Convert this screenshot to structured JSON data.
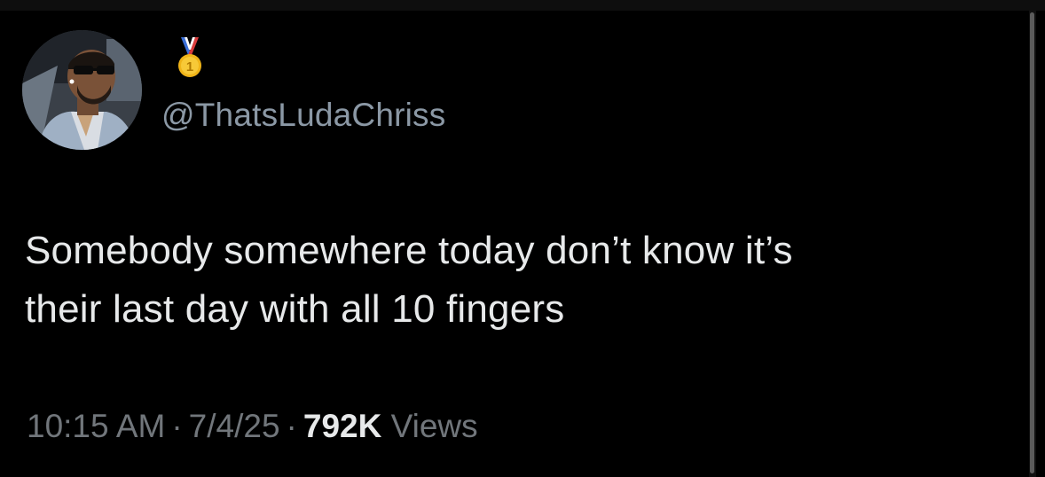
{
  "tweet": {
    "author": {
      "handle": "@ThatsLudaChriss",
      "badge_icon": "first-place-medal-icon",
      "avatar_icon": "profile-photo"
    },
    "text_line_1": "Somebody somewhere today don’t know it’s",
    "text_line_2": "their last day with all 10 fingers",
    "time": "10:15 AM",
    "separator": "·",
    "date": "7/4/25",
    "views_count": "792K",
    "views_label": "Views"
  },
  "colors": {
    "background": "#000000",
    "primary_text": "#e7e9ea",
    "secondary_text": "#71767b",
    "handle_text": "#8b98a5"
  }
}
